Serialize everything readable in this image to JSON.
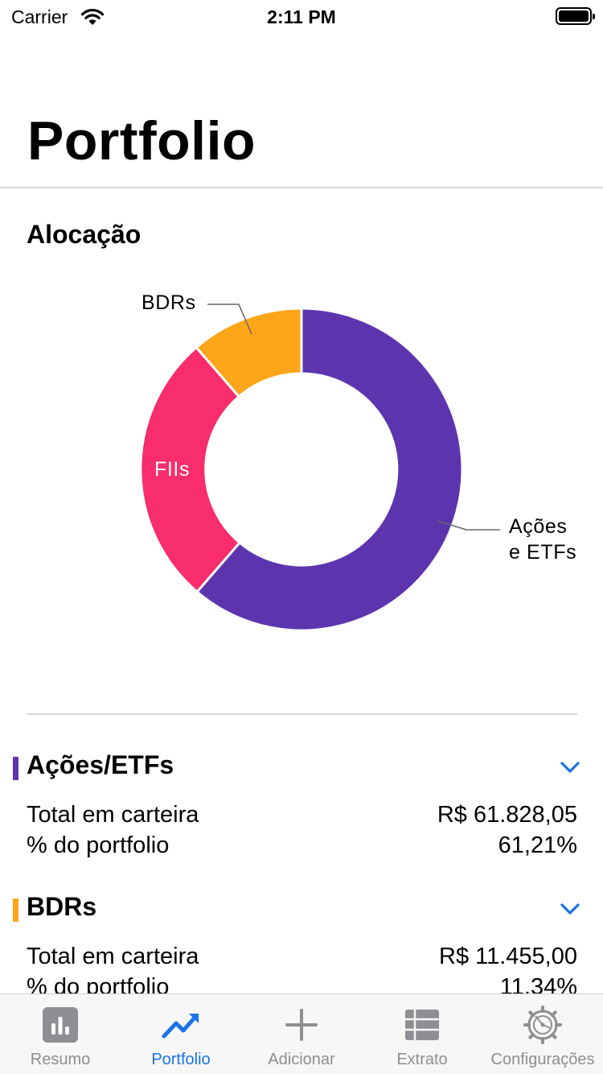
{
  "status_bar": {
    "carrier": "Carrier",
    "time": "2:11 PM"
  },
  "header": {
    "title": "Portfolio"
  },
  "allocation": {
    "title": "Alocação",
    "labels": {
      "bdrs": "BDRs",
      "fiis": "FIIs",
      "acoes_line1": "Ações",
      "acoes_line2": "e ETFs"
    }
  },
  "categories": [
    {
      "title": "Ações/ETFs",
      "color": "#5c35ae",
      "total_label": "Total em carteira",
      "total_value": "R$ 61.828,05",
      "percent_label": "% do portfolio",
      "percent_value": "61,21%"
    },
    {
      "title": "BDRs",
      "color": "#ffa51a",
      "total_label": "Total em carteira",
      "total_value": "R$ 11.455,00",
      "percent_label": "% do portfolio",
      "percent_value": "11,34%"
    }
  ],
  "tabs": [
    {
      "label": "Resumo",
      "icon": "bar-chart-icon",
      "active": false
    },
    {
      "label": "Portfolio",
      "icon": "trending-up-icon",
      "active": true
    },
    {
      "label": "Adicionar",
      "icon": "plus-icon",
      "active": false
    },
    {
      "label": "Extrato",
      "icon": "list-icon",
      "active": false
    },
    {
      "label": "Configurações",
      "icon": "gear-icon",
      "active": false
    }
  ],
  "colors": {
    "acoes": "#5c35ae",
    "fiis": "#f72d6c",
    "bdrs": "#ffa51a",
    "accent": "#1a73e8",
    "inactive": "#8e8e93"
  }
}
